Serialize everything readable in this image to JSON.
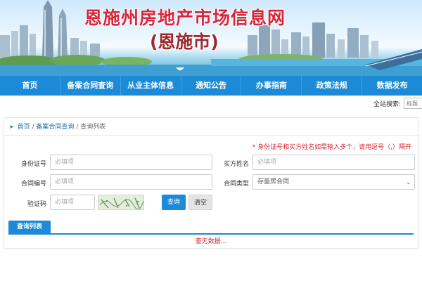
{
  "header": {
    "title": "恩施州房地产市场信息网",
    "subtitle": "(恩施市)"
  },
  "nav": {
    "items": [
      "首页",
      "备案合同查询",
      "从业主体信息",
      "通知公告",
      "办事指南",
      "政策法规",
      "数据发布"
    ]
  },
  "site_search": {
    "label": "全站搜索:",
    "placeholder": "标题"
  },
  "breadcrumb": {
    "home": "首页",
    "section": "备案合同查询",
    "separator": "/",
    "current": "查询列表"
  },
  "form": {
    "notice": "* 身份证号和买方姓名如需输入多个，请用逗号（,）隔开",
    "id_label": "身份证号",
    "id_placeholder": "必填项",
    "buyer_label": "买方姓名",
    "buyer_placeholder": "必填项",
    "contract_label": "合同编号",
    "contract_placeholder": "必填项",
    "type_label": "合同类型",
    "type_value": "存量房合同",
    "captcha_label": "验证码",
    "captcha_placeholder": "必填项",
    "query_button": "查询",
    "clear_button": "清空"
  },
  "results": {
    "tab_label": "查询列表",
    "empty_text": "查无数据..."
  },
  "colors": {
    "accent": "#1c8ad6",
    "title_red": "#d8263a",
    "warning": "#d8263a"
  },
  "icons": [
    "location-arrow-icon",
    "chevron-down-icon"
  ]
}
